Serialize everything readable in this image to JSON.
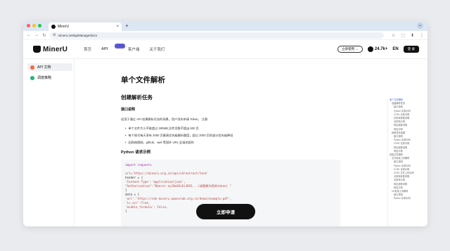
{
  "browser": {
    "tab_title": "MinerU",
    "tab_close": "×",
    "new_tab": "+",
    "url": "mineru.net/apiManage/docs",
    "traffic_colors": [
      "#ff5f57",
      "#febc2e",
      "#28c840"
    ]
  },
  "site": {
    "logo_text": "MinerU",
    "nav": [
      {
        "label": "首页"
      },
      {
        "label": "API",
        "badge": "new"
      },
      {
        "label": "客户端"
      },
      {
        "label": "关于我们"
      }
    ],
    "apply_label": "立即使用 →",
    "github_stars": "24.7k+",
    "lang": "EN",
    "login_label": "登 录"
  },
  "sidebar": {
    "items": [
      {
        "label": "API 文档",
        "color": "#f26b3a"
      },
      {
        "label": "调度策略",
        "color": "#22b573"
      }
    ]
  },
  "content": {
    "title": "单个文件解析",
    "section_title": "创建解析任务",
    "subsection": "接口说明",
    "desc": "适用于通过 API 创建解析任务的场景，用户须先申请 Token。 注意:",
    "bullets": [
      "单个文件大小不能超过 200MB,文件页数不超出 600 页",
      "每个账号每天享有 2000 页最高优先级解析额度，超过 2000 页的部分优先级降低",
      "因网络限制，github、aws 等国外 URL 会请求超时"
    ],
    "python_title": "Python 请求示例",
    "code_lines": [
      "import requests",
      "",
      "url='https://mineru.org.cn/api/v4/extract/task'",
      "header = {",
      "    'Content-Type':'application/json',",
      "    \"Authorization\":\"Bearer eyJ0eXAiOiJKV1...(请替换为您的token) \"",
      "}",
      "data = {",
      "    'url':'https://cdn-mineru.openxlab.org.cn/demo/example.pdf',",
      "    'is_ocr':True,",
      "    'enable_formula': False,",
      "}"
    ],
    "cta_label": "立即申请"
  },
  "toc": {
    "items": [
      {
        "label": "单个文件解析",
        "level": 1,
        "active": true
      },
      {
        "label": "创建解析任务",
        "level": 2
      },
      {
        "label": "接口说明",
        "level": 3
      },
      {
        "label": "Python 请求示例",
        "level": 3
      },
      {
        "label": "CURL 请求示例",
        "level": 3
      },
      {
        "label": "请求体参数说明",
        "level": 3
      },
      {
        "label": "请求体示例",
        "level": 3
      },
      {
        "label": "响应参数说明",
        "level": 3
      },
      {
        "label": "响应示例",
        "level": 3
      },
      {
        "label": "获取任务结果",
        "level": 2
      },
      {
        "label": "接口说明",
        "level": 3
      },
      {
        "label": "Python 请求示例",
        "level": 3
      },
      {
        "label": "CURL 请求示例",
        "level": 3
      },
      {
        "label": "响应参数说明",
        "level": 3
      },
      {
        "label": "响应示例",
        "level": 3
      },
      {
        "label": "批量文件解析",
        "level": 1
      },
      {
        "label": "文件批量上传解析",
        "level": 2
      },
      {
        "label": "接口说明",
        "level": 3
      },
      {
        "label": "Python 请求示例",
        "level": 3
      },
      {
        "label": "CURL 请求示例",
        "level": 3
      },
      {
        "label": "CURL 文件上传示例",
        "level": 3
      },
      {
        "label": "请求体参数说明",
        "level": 3
      },
      {
        "label": "请求体示例",
        "level": 3
      },
      {
        "label": "响应参数说明",
        "level": 3
      },
      {
        "label": "响应示例",
        "level": 3
      },
      {
        "label": "url 批量上传解析",
        "level": 2
      },
      {
        "label": "接口说明",
        "level": 3
      },
      {
        "label": "Python 请求示例",
        "level": 3
      }
    ]
  }
}
